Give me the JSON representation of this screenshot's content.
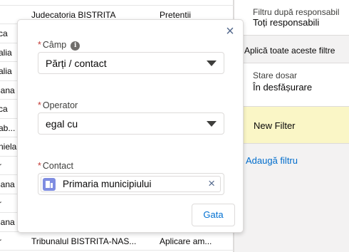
{
  "table": {
    "rows": [
      {
        "c1": "",
        "c2": "Judecatoria BISTRITA",
        "c3": "Pretentii"
      },
      {
        "c1": "",
        "c2": "Judecatoria BISTRITA",
        "c3": "Pretentii"
      },
      {
        "c1": "ca",
        "c2": "",
        "c3": ""
      },
      {
        "c1": "alia",
        "c2": "",
        "c3": ""
      },
      {
        "c1": "alia",
        "c2": "",
        "c3": ""
      },
      {
        "c1": "lana",
        "c2": "",
        "c3": ""
      },
      {
        "c1": "ca",
        "c2": "",
        "c3": ""
      },
      {
        "c1": "ab...",
        "c2": "",
        "c3": ""
      },
      {
        "c1": "niela",
        "c2": "",
        "c3": ""
      },
      {
        "c1": "r",
        "c2": "",
        "c3": ""
      },
      {
        "c1": "lana",
        "c2": "",
        "c3": ""
      },
      {
        "c1": "r",
        "c2": "",
        "c3": ""
      },
      {
        "c1": "lana",
        "c2": "",
        "c3": ""
      },
      {
        "c1": "r",
        "c2": "Tribunalul BISTRITA-NAS...",
        "c3": "Aplicare am..."
      }
    ]
  },
  "panel": {
    "responsible_label": "Filtru după responsabil",
    "responsible_value": "Toți responsabili",
    "apply_all": "Aplică toate aceste filtre",
    "status_label": "Stare dosar",
    "status_value": "În desfășurare",
    "new_filter": "New Filter",
    "add_filter": "Adaugă filtru"
  },
  "popover": {
    "close": "×",
    "field_required": "*",
    "field_label": "Câmp",
    "info_icon": "i",
    "field_value": "Părți / contact",
    "operator_label": "Operator",
    "operator_value": "egal cu",
    "contact_label": "Contact",
    "contact_value": "Primaria municipiului",
    "remove": "×",
    "done": "Gata"
  }
}
